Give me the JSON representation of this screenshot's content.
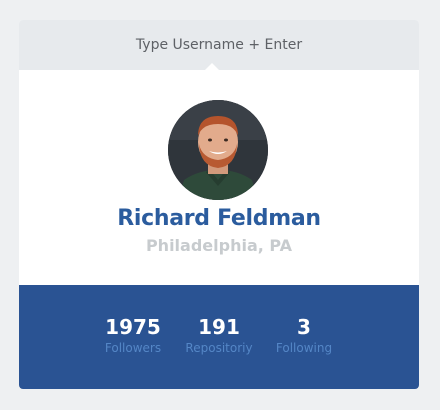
{
  "search": {
    "placeholder": "Type Username + Enter",
    "value": ""
  },
  "profile": {
    "avatar_alt": "avatar",
    "name": "Richard Feldman",
    "location": "Philadelphia, PA"
  },
  "stats": [
    {
      "value": "1975",
      "label": "Followers"
    },
    {
      "value": "191",
      "label": "Repositoriy"
    },
    {
      "value": "3",
      "label": "Following"
    }
  ],
  "colors": {
    "page_bg": "#eef0f2",
    "search_bg": "#e7eaed",
    "name": "#2b5c9e",
    "location": "#c7cbce",
    "stats_bg": "#2a5393",
    "stats_label": "#5486c6"
  }
}
